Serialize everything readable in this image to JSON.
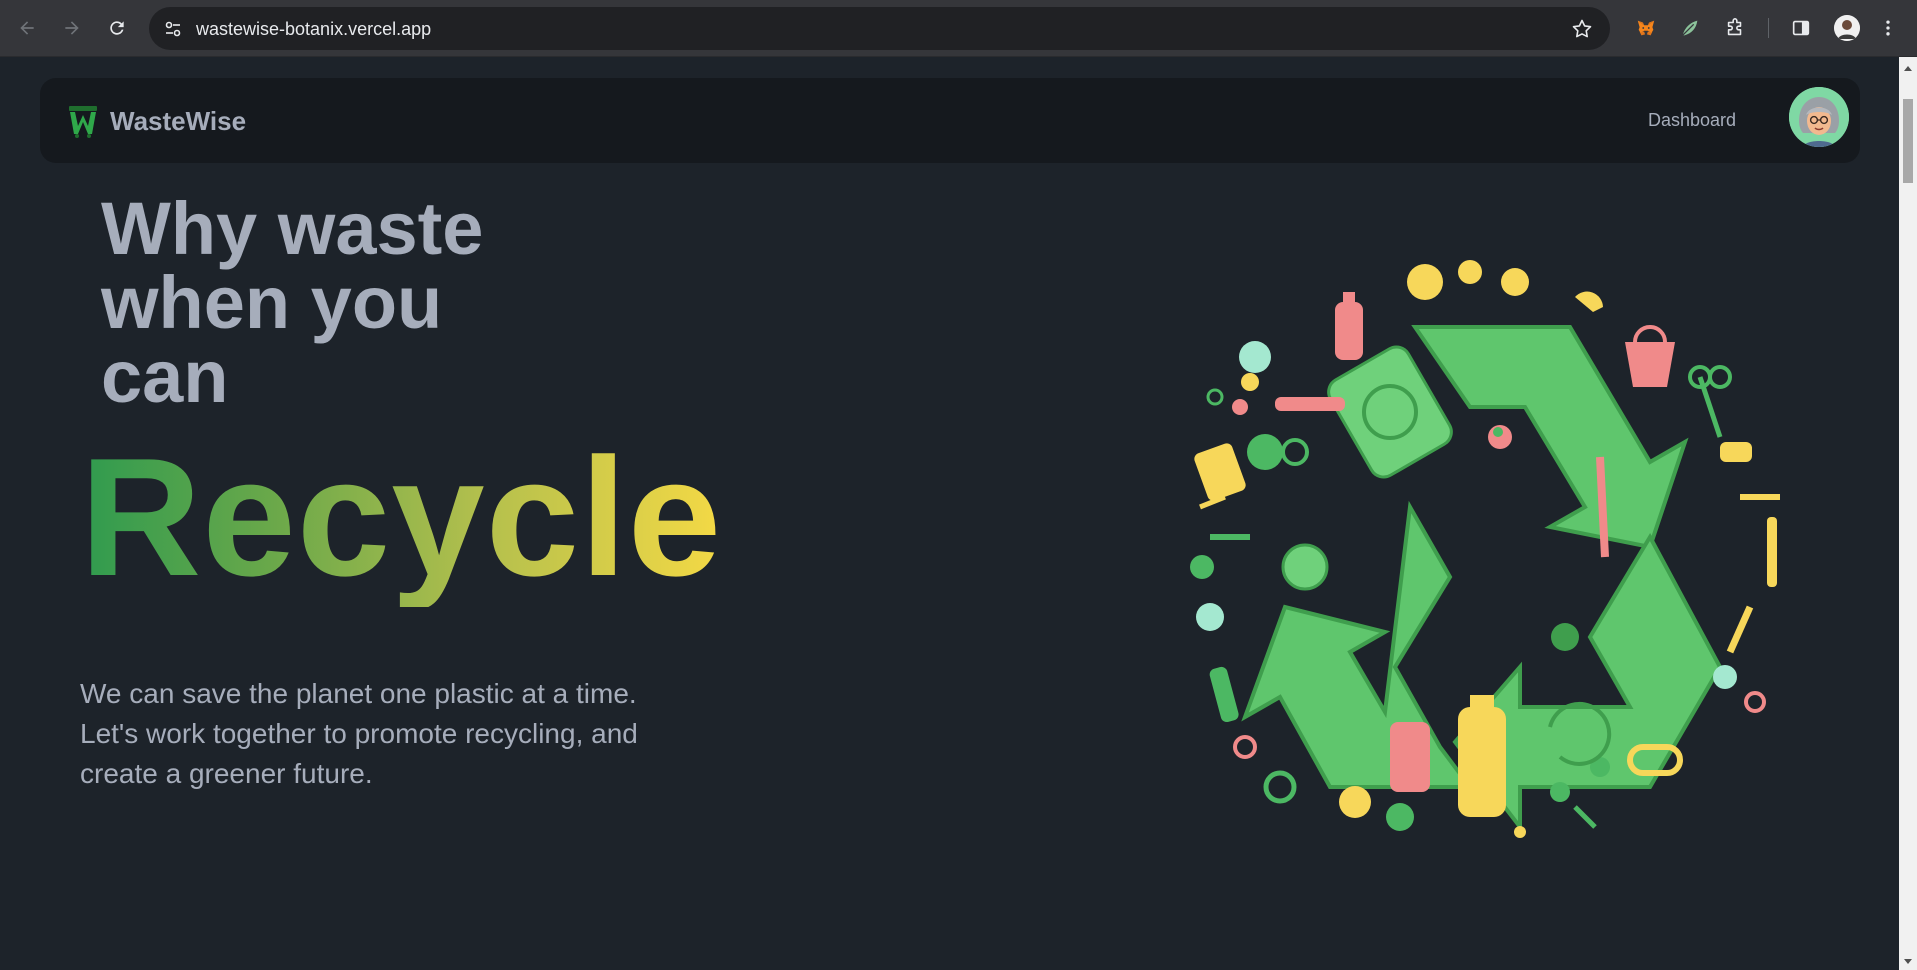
{
  "browser": {
    "url": "wastewise-botanix.vercel.app",
    "back_icon": "arrow-left-icon",
    "forward_icon": "arrow-right-icon",
    "reload_icon": "reload-icon",
    "bookmark_icon": "star-icon"
  },
  "navbar": {
    "brand_name": "WasteWise",
    "links": [
      {
        "label": "Dashboard"
      }
    ]
  },
  "hero": {
    "heading": "Why waste when you can",
    "highlight": "Recycle",
    "subtext_line1": "We can save the planet one plastic at a time.",
    "subtext_line2": "Let's work together to promote recycling, and create a greener future."
  },
  "colors": {
    "page_bg": "#1d232a",
    "navbar_bg": "#15191e",
    "text": "#a6adbb",
    "gradient_start": "#2f9b4f",
    "gradient_end": "#f4d945",
    "recycle_green": "#5fc66d"
  }
}
